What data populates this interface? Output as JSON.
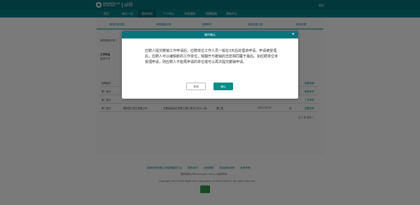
{
  "header": {
    "logo_line1": "国家电网有限公司",
    "logo_line2": "STATE GRID",
    "logo_sub1": "人才招聘",
    "logo_sub2": "服务平台",
    "logout": "退出"
  },
  "nav": {
    "items": [
      "首页",
      "单位一览",
      "我的求职",
      "个人中心",
      "消息通知",
      "招聘指南",
      "帮助中心"
    ],
    "active_index": 2
  },
  "subtabs": [
    "简历投递记录",
    "我的撤销记录",
    "应聘单位",
    "简历变更记录",
    "报名申请"
  ],
  "breadcrumb": "我的撤销记录 /",
  "section": {
    "title": "工作单位",
    "hint": "撤销申请"
  },
  "table": {
    "rows": [
      {
        "c1": "应聘批次",
        "c2": "",
        "c3": "",
        "c4": "",
        "c5": "",
        "c6": "",
        "link": "查看详细"
      },
      {
        "c1": "第一批次",
        "c2": "",
        "c3": "",
        "c4": "",
        "c5": "",
        "c6": "",
        "link": "撤销申请"
      },
      {
        "c1": "第二批次",
        "c2": "",
        "c3": "",
        "c4": "",
        "c5": "",
        "c6": "",
        "link": "工作申请"
      },
      {
        "c1": "第三批次",
        "c2": "国网浙江电力有限公司",
        "c3": "主要技能岗位专项(乙类1)考试(3天)1-4名",
        "c4": "第三批",
        "c5": "2020-03-02",
        "c6": "否",
        "link": "查看详情"
      }
    ],
    "pager": "共 1 条  首页 1"
  },
  "footer": {
    "links": [
      "国家电网有限公司招聘服务平台",
      "联系我们",
      "使用帮助",
      "网站使用说明",
      "免责声明"
    ],
    "email": "国家电网公司(www.sgcc.com.cn)版权所有",
    "copyright": "Copyright 2011-2020 State Grid Corporation of China (SGCC). All rights reserved.",
    "badge_label": "Site"
  },
  "modal": {
    "title": "操作确认",
    "close_glyph": "×",
    "message": "应聘人提交撤销工作申请后，应聘单位工作人员一般在3天后处理该申请。申请被受理后，应聘人可以编辑新的工作单位，我翻开与撤销的志愿相同覆于最后。如应聘单位未受理申请，则应聘人不能再申请的单位或可以再次提交撤销申请。",
    "cancel_label": "关闭",
    "ok_label": "确认"
  },
  "colors": {
    "brand": "#06747c",
    "accent": "#0a8d87"
  }
}
